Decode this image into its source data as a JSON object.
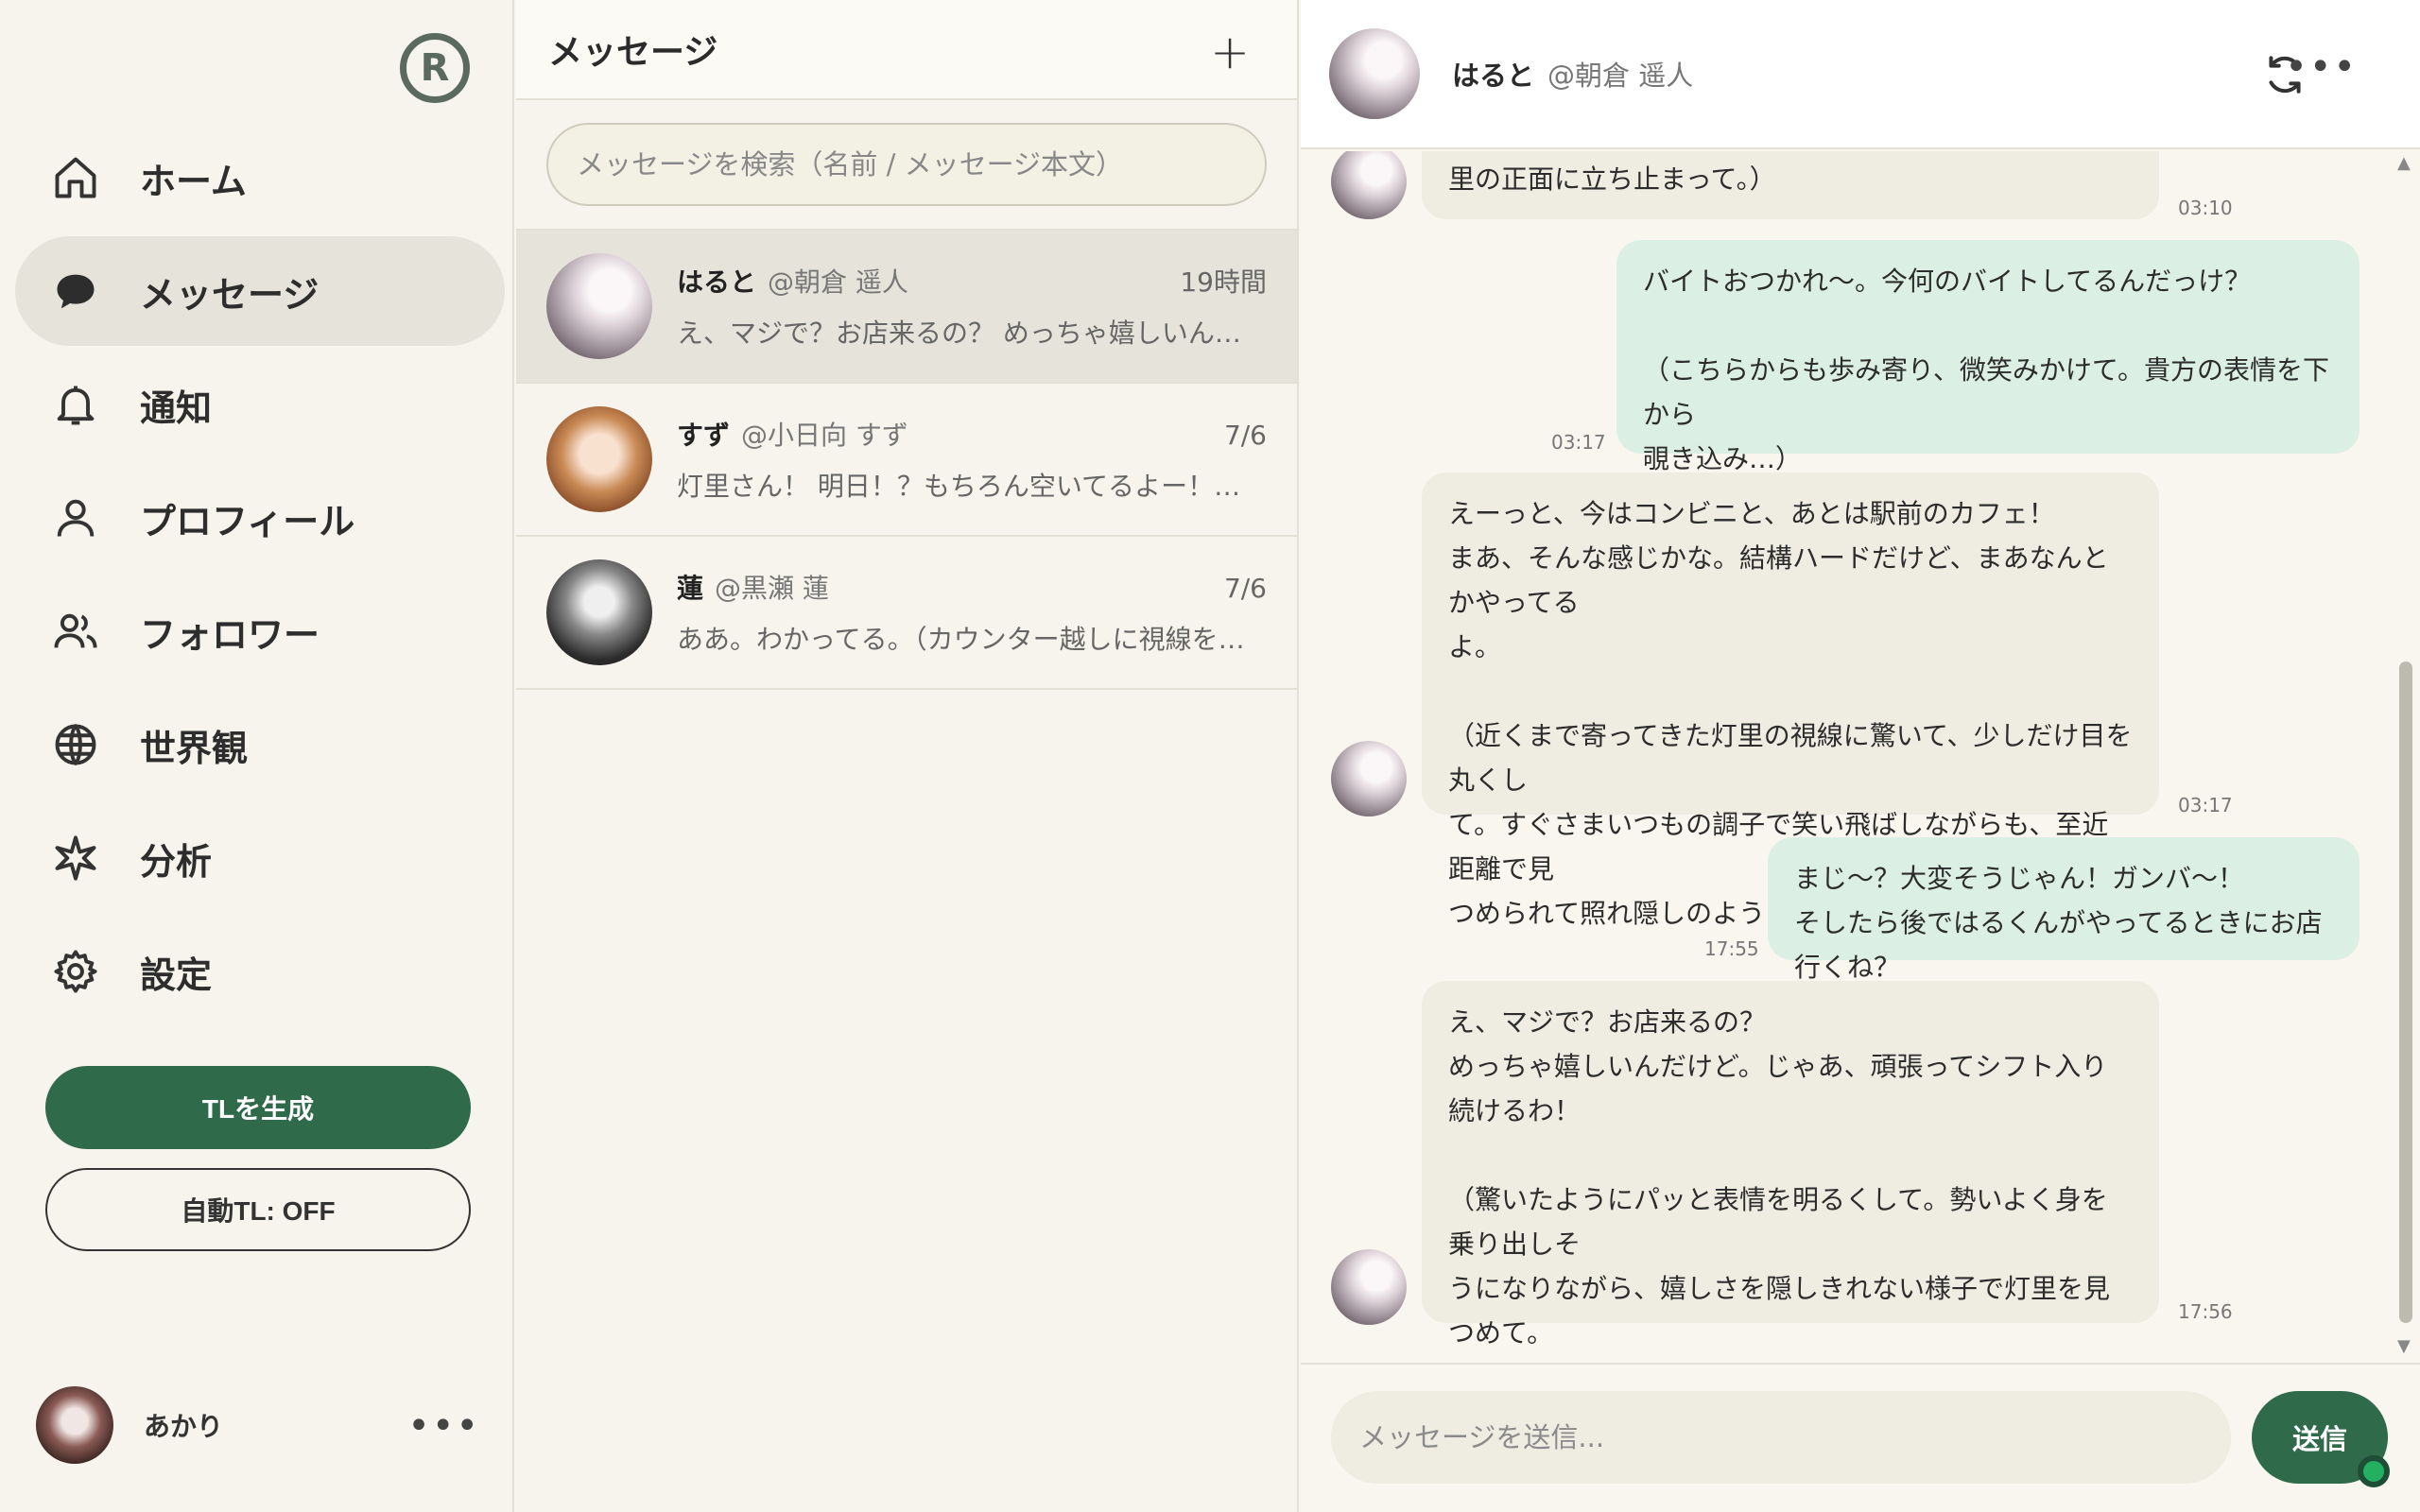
{
  "sidebar": {
    "logo_letter": "R",
    "nav": [
      {
        "label": "ホーム",
        "icon": "home-icon"
      },
      {
        "label": "メッセージ",
        "icon": "chat-bubble-icon",
        "active": true
      },
      {
        "label": "通知",
        "icon": "bell-icon"
      },
      {
        "label": "プロフィール",
        "icon": "user-icon"
      },
      {
        "label": "フォロワー",
        "icon": "users-icon"
      },
      {
        "label": "世界観",
        "icon": "globe-icon"
      },
      {
        "label": "分析",
        "icon": "sparkle-icon"
      },
      {
        "label": "設定",
        "icon": "gear-icon"
      }
    ],
    "generate_tl": "TLを生成",
    "auto_tl": "自動TL: OFF",
    "user_name": "あかり",
    "more": "•••"
  },
  "list": {
    "title": "メッセージ",
    "new_button": "+",
    "search_placeholder": "メッセージを検索（名前 / メッセージ本文）",
    "conversations": [
      {
        "name": "はると",
        "handle": "@朝倉 遥人",
        "time": "19時間",
        "preview": "え、マジで？お店来るの？ めっちゃ嬉しいんだけど。じゃあ、頑張ってシフト入り続けるわ！"
      },
      {
        "name": "すず",
        "handle": "@小日向 すず",
        "time": "7/6",
        "preview": "灯里さん！ 明日！？もちろん空いてるよー！やばっ、すっごい楽しみ！"
      },
      {
        "name": "蓮",
        "handle": "@黒瀬 蓮",
        "time": "7/6",
        "preview": "ああ。わかってる。（カウンター越しに視線を向けて、静かに頷いて）"
      }
    ]
  },
  "chat": {
    "name": "はると",
    "handle": "@朝倉 遥人",
    "more": "•••",
    "messages": [
      {
        "dir": "in",
        "text": "里の正面に立ち止まって。）",
        "time": "03:10"
      },
      {
        "dir": "out",
        "text": "バイトおつかれ〜。今何のバイトしてるんだっけ？\n\n（こちらからも歩み寄り、微笑みかけて。貴方の表情を下から\n覗き込み…）",
        "time": "03:17"
      },
      {
        "dir": "in",
        "text": "えーっと、今はコンビニと、あとは駅前のカフェ！\nまあ、そんな感じかな。結構ハードだけど、まあなんとかやってる\nよ。\n\n（近くまで寄ってきた灯里の視線に驚いて、少しだけ目を丸くし\nて。すぐさまいつもの調子で笑い飛ばしながらも、至近距離で見\nつめられて照れ隠しのように後頭部を軽く掻いて。）",
        "time": "03:17"
      },
      {
        "dir": "out",
        "text": "まじ〜？大変そうじゃん！ガンバ〜！\nそしたら後ではるくんがやってるときにお店行くね？",
        "time": "17:55"
      },
      {
        "dir": "in",
        "text": "え、マジで？お店来るの？\nめっちゃ嬉しいんだけど。じゃあ、頑張ってシフト入り続けるわ！\n\n（驚いたようにパッと表情を明るくして。勢いよく身を乗り出しそ\nうになりながら、嬉しさを隠しきれない様子で灯里を見つめて。\n照れが少し残るのか、また後頭部をぽさぽさと掻いて、照れくさ\nそうに笑う。）",
        "time": "17:56"
      }
    ],
    "composer_placeholder": "メッセージを送信...",
    "send_label": "送信"
  },
  "colors": {
    "accent": "#2f6a4a",
    "bubble_in": "#efece1",
    "bubble_out": "#dcefe4",
    "background": "#f7f5ee"
  }
}
